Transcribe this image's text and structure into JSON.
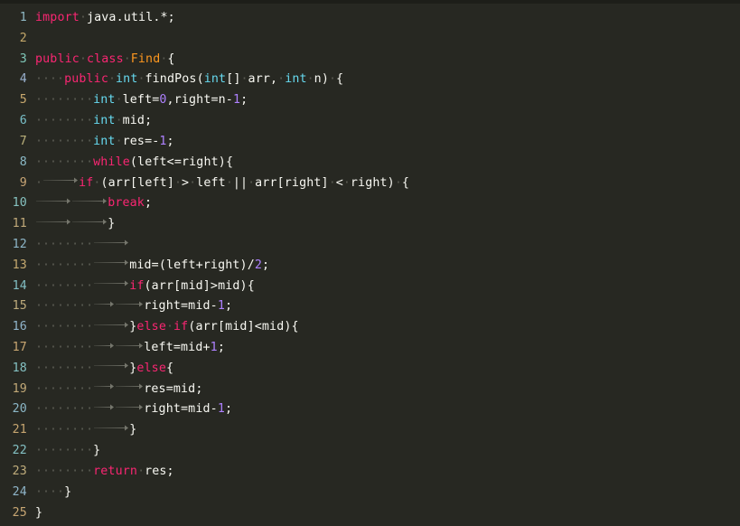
{
  "editor": {
    "language": "java",
    "theme": "monokai-dark",
    "background_color": "#272822",
    "top_bar_color": "#1d1e19",
    "whitespace_markers_visible": true,
    "space_marker_glyph": "·",
    "tab_marker_glyph": "→",
    "total_lines": 25,
    "colors": {
      "keyword": "#f92672",
      "type": "#66d9ef",
      "class_name": "#fd971f",
      "number": "#ae81ff",
      "identifier": "#f8f8f2",
      "punctuation": "#f8f8f2",
      "whitespace_marker": "#5a5b52"
    }
  },
  "gutter": {
    "line_numbers": [
      "1",
      "2",
      "3",
      "4",
      "5",
      "6",
      "7",
      "8",
      "9",
      "10",
      "11",
      "12",
      "13",
      "14",
      "15",
      "16",
      "17",
      "18",
      "19",
      "20",
      "21",
      "22",
      "23",
      "24",
      "25"
    ],
    "number_colors": [
      "#8fb8c4",
      "#c4a86a",
      "#7fc7b8",
      "#9ab2d0",
      "#c9a96e",
      "#79c0c9",
      "#b9b07a",
      "#8ab9c6",
      "#c7a474",
      "#86c2c0",
      "#c0a878",
      "#8db6c8",
      "#c5a96f",
      "#82bfc4",
      "#beab7c",
      "#90b4cb",
      "#c8a671",
      "#84c1c2",
      "#c2a977",
      "#8bb7c7",
      "#c6a570",
      "#83c0c3",
      "#bfac7b",
      "#8fb5c9",
      "#c7a673"
    ]
  },
  "code": {
    "lines": [
      {
        "n": "1",
        "tokens": [
          {
            "t": "kw",
            "v": "import"
          },
          {
            "t": "sp",
            "v": 1
          },
          {
            "t": "txt",
            "v": "java.util.*;"
          }
        ]
      },
      {
        "n": "2",
        "tokens": []
      },
      {
        "n": "3",
        "tokens": [
          {
            "t": "kw",
            "v": "public"
          },
          {
            "t": "sp",
            "v": 1
          },
          {
            "t": "kw",
            "v": "class"
          },
          {
            "t": "sp",
            "v": 1
          },
          {
            "t": "cls",
            "v": "Find"
          },
          {
            "t": "sp",
            "v": 1
          },
          {
            "t": "pun",
            "v": "{"
          }
        ]
      },
      {
        "n": "4",
        "tokens": [
          {
            "t": "sp",
            "v": 4
          },
          {
            "t": "kw",
            "v": "public"
          },
          {
            "t": "sp",
            "v": 1
          },
          {
            "t": "type",
            "v": "int"
          },
          {
            "t": "sp",
            "v": 1
          },
          {
            "t": "txt",
            "v": "findPos("
          },
          {
            "t": "type",
            "v": "int"
          },
          {
            "t": "txt",
            "v": "[]"
          },
          {
            "t": "sp",
            "v": 1
          },
          {
            "t": "txt",
            "v": "arr,"
          },
          {
            "t": "sp",
            "v": 1
          },
          {
            "t": "type",
            "v": "int"
          },
          {
            "t": "sp",
            "v": 1
          },
          {
            "t": "txt",
            "v": "n)"
          },
          {
            "t": "sp",
            "v": 1
          },
          {
            "t": "pun",
            "v": "{"
          }
        ]
      },
      {
        "n": "5",
        "tokens": [
          {
            "t": "sp",
            "v": 8
          },
          {
            "t": "type",
            "v": "int"
          },
          {
            "t": "sp",
            "v": 1
          },
          {
            "t": "txt",
            "v": "left="
          },
          {
            "t": "num",
            "v": "0"
          },
          {
            "t": "txt",
            "v": ",right=n-"
          },
          {
            "t": "num",
            "v": "1"
          },
          {
            "t": "txt",
            "v": ";"
          }
        ]
      },
      {
        "n": "6",
        "tokens": [
          {
            "t": "sp",
            "v": 8
          },
          {
            "t": "type",
            "v": "int"
          },
          {
            "t": "sp",
            "v": 1
          },
          {
            "t": "txt",
            "v": "mid;"
          }
        ]
      },
      {
        "n": "7",
        "tokens": [
          {
            "t": "sp",
            "v": 8
          },
          {
            "t": "type",
            "v": "int"
          },
          {
            "t": "sp",
            "v": 1
          },
          {
            "t": "txt",
            "v": "res=-"
          },
          {
            "t": "num",
            "v": "1"
          },
          {
            "t": "txt",
            "v": ";"
          }
        ]
      },
      {
        "n": "8",
        "tokens": [
          {
            "t": "sp",
            "v": 8
          },
          {
            "t": "kw",
            "v": "while"
          },
          {
            "t": "txt",
            "v": "(left<=right)"
          },
          {
            "t": "pun",
            "v": "{"
          }
        ]
      },
      {
        "n": "9",
        "tokens": [
          {
            "t": "sp",
            "v": 1
          },
          {
            "t": "tab",
            "v": 5
          },
          {
            "t": "kw",
            "v": "if"
          },
          {
            "t": "sp",
            "v": 1
          },
          {
            "t": "txt",
            "v": "(arr[left]"
          },
          {
            "t": "sp",
            "v": 1
          },
          {
            "t": "op",
            "v": ">"
          },
          {
            "t": "sp",
            "v": 1
          },
          {
            "t": "txt",
            "v": "left"
          },
          {
            "t": "sp",
            "v": 1
          },
          {
            "t": "op",
            "v": "||"
          },
          {
            "t": "sp",
            "v": 1
          },
          {
            "t": "txt",
            "v": "arr[right]"
          },
          {
            "t": "sp",
            "v": 1
          },
          {
            "t": "op",
            "v": "<"
          },
          {
            "t": "sp",
            "v": 1
          },
          {
            "t": "txt",
            "v": "right)"
          },
          {
            "t": "sp",
            "v": 1
          },
          {
            "t": "pun",
            "v": "{"
          }
        ]
      },
      {
        "n": "10",
        "tokens": [
          {
            "t": "tab",
            "v": 5
          },
          {
            "t": "tab",
            "v": 5
          },
          {
            "t": "kw",
            "v": "break"
          },
          {
            "t": "txt",
            "v": ";"
          }
        ]
      },
      {
        "n": "11",
        "tokens": [
          {
            "t": "tab",
            "v": 5
          },
          {
            "t": "tab",
            "v": 5
          },
          {
            "t": "pun",
            "v": "}"
          }
        ]
      },
      {
        "n": "12",
        "tokens": [
          {
            "t": "sp",
            "v": 8
          },
          {
            "t": "tab",
            "v": 5
          }
        ]
      },
      {
        "n": "13",
        "tokens": [
          {
            "t": "sp",
            "v": 8
          },
          {
            "t": "tab",
            "v": 5
          },
          {
            "t": "txt",
            "v": "mid=(left+right)"
          },
          {
            "t": "op",
            "v": "/"
          },
          {
            "t": "num",
            "v": "2"
          },
          {
            "t": "txt",
            "v": ";"
          }
        ]
      },
      {
        "n": "14",
        "tokens": [
          {
            "t": "sp",
            "v": 8
          },
          {
            "t": "tab",
            "v": 5
          },
          {
            "t": "kw",
            "v": "if"
          },
          {
            "t": "txt",
            "v": "(arr[mid]>mid)"
          },
          {
            "t": "pun",
            "v": "{"
          }
        ]
      },
      {
        "n": "15",
        "tokens": [
          {
            "t": "sp",
            "v": 8
          },
          {
            "t": "tab",
            "v": 3
          },
          {
            "t": "tab",
            "v": 4
          },
          {
            "t": "txt",
            "v": "right=mid-"
          },
          {
            "t": "num",
            "v": "1"
          },
          {
            "t": "txt",
            "v": ";"
          }
        ]
      },
      {
        "n": "16",
        "tokens": [
          {
            "t": "sp",
            "v": 8
          },
          {
            "t": "tab",
            "v": 5
          },
          {
            "t": "pun",
            "v": "}"
          },
          {
            "t": "kw",
            "v": "else"
          },
          {
            "t": "sp",
            "v": 1
          },
          {
            "t": "kw",
            "v": "if"
          },
          {
            "t": "txt",
            "v": "(arr[mid]<mid)"
          },
          {
            "t": "pun",
            "v": "{"
          }
        ]
      },
      {
        "n": "17",
        "tokens": [
          {
            "t": "sp",
            "v": 8
          },
          {
            "t": "tab",
            "v": 3
          },
          {
            "t": "tab",
            "v": 4
          },
          {
            "t": "txt",
            "v": "left=mid+"
          },
          {
            "t": "num",
            "v": "1"
          },
          {
            "t": "txt",
            "v": ";"
          }
        ]
      },
      {
        "n": "18",
        "tokens": [
          {
            "t": "sp",
            "v": 8
          },
          {
            "t": "tab",
            "v": 5
          },
          {
            "t": "pun",
            "v": "}"
          },
          {
            "t": "kw",
            "v": "else"
          },
          {
            "t": "pun",
            "v": "{"
          }
        ]
      },
      {
        "n": "19",
        "tokens": [
          {
            "t": "sp",
            "v": 8
          },
          {
            "t": "tab",
            "v": 3
          },
          {
            "t": "tab",
            "v": 4
          },
          {
            "t": "txt",
            "v": "res=mid;"
          }
        ]
      },
      {
        "n": "20",
        "tokens": [
          {
            "t": "sp",
            "v": 8
          },
          {
            "t": "tab",
            "v": 3
          },
          {
            "t": "tab",
            "v": 4
          },
          {
            "t": "txt",
            "v": "right=mid-"
          },
          {
            "t": "num",
            "v": "1"
          },
          {
            "t": "txt",
            "v": ";"
          }
        ]
      },
      {
        "n": "21",
        "tokens": [
          {
            "t": "sp",
            "v": 8
          },
          {
            "t": "tab",
            "v": 5
          },
          {
            "t": "pun",
            "v": "}"
          }
        ]
      },
      {
        "n": "22",
        "tokens": [
          {
            "t": "sp",
            "v": 8
          },
          {
            "t": "pun",
            "v": "}"
          }
        ]
      },
      {
        "n": "23",
        "tokens": [
          {
            "t": "sp",
            "v": 8
          },
          {
            "t": "kw",
            "v": "return"
          },
          {
            "t": "sp",
            "v": 1
          },
          {
            "t": "txt",
            "v": "res;"
          }
        ]
      },
      {
        "n": "24",
        "tokens": [
          {
            "t": "sp",
            "v": 4
          },
          {
            "t": "pun",
            "v": "}"
          }
        ]
      },
      {
        "n": "25",
        "tokens": [
          {
            "t": "pun",
            "v": "}"
          }
        ]
      }
    ]
  },
  "source_text": "import java.util.*;\n\npublic class Find {\n    public int findPos(int[] arr, int n) {\n        int left=0,right=n-1;\n        int mid;\n        int res=-1;\n        while(left<=right){\n            if (arr[left] > left || arr[right] < right) {\n                break;\n            }\n\n            mid=(left+right)/2;\n            if(arr[mid]>mid){\n                right=mid-1;\n            }else if(arr[mid]<mid){\n                left=mid+1;\n            }else{\n                res=mid;\n                right=mid-1;\n            }\n        }\n        return res;\n    }\n}"
}
